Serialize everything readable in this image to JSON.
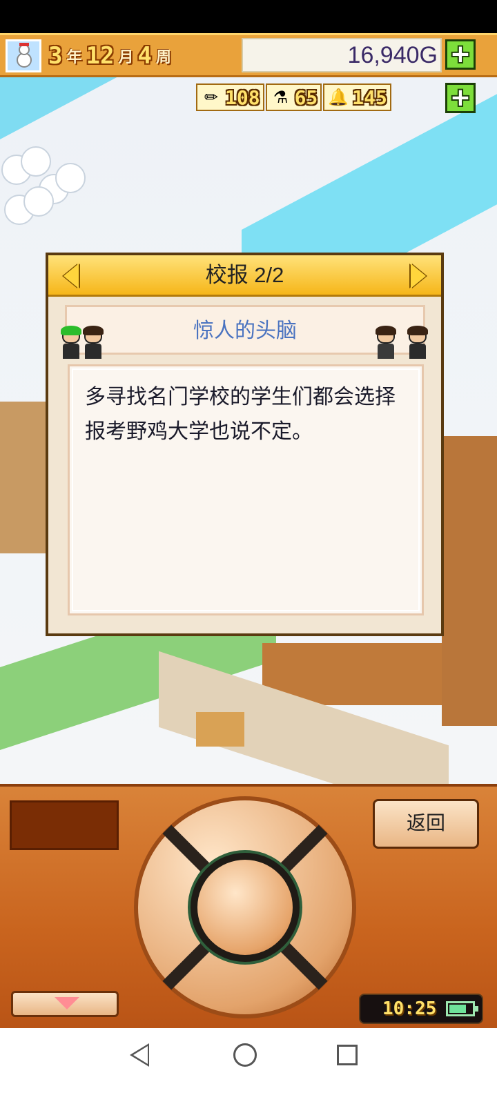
{
  "hud": {
    "year_value": "3",
    "year_unit": "年",
    "month_value": "12",
    "month_unit": "月",
    "week_value": "4",
    "week_unit": "周",
    "money": "16,940G",
    "avatar_icon": "snowman-icon",
    "add_money_icon": "plus-icon"
  },
  "resources": [
    {
      "icon": "pencil-icon",
      "value": "108"
    },
    {
      "icon": "flask-icon",
      "value": "65"
    },
    {
      "icon": "bell-icon",
      "value": "145"
    }
  ],
  "dialog": {
    "title": "校报 2/2",
    "subtitle": "惊人的头脑",
    "body": "多寻找名门学校的学生们都会选择报考野鸡大学也说不定。",
    "prev_icon": "arrow-left-icon",
    "next_icon": "arrow-right-icon"
  },
  "panel": {
    "back_label": "返回",
    "clock": "10:25",
    "battery_level": 0.75
  },
  "colors": {
    "hud_bg": "#e9a23b",
    "dialog_header": "#f6b619",
    "subtitle_text": "#4a73c0",
    "panel_bg": "#c9641e",
    "plus_green": "#7dde3b"
  }
}
